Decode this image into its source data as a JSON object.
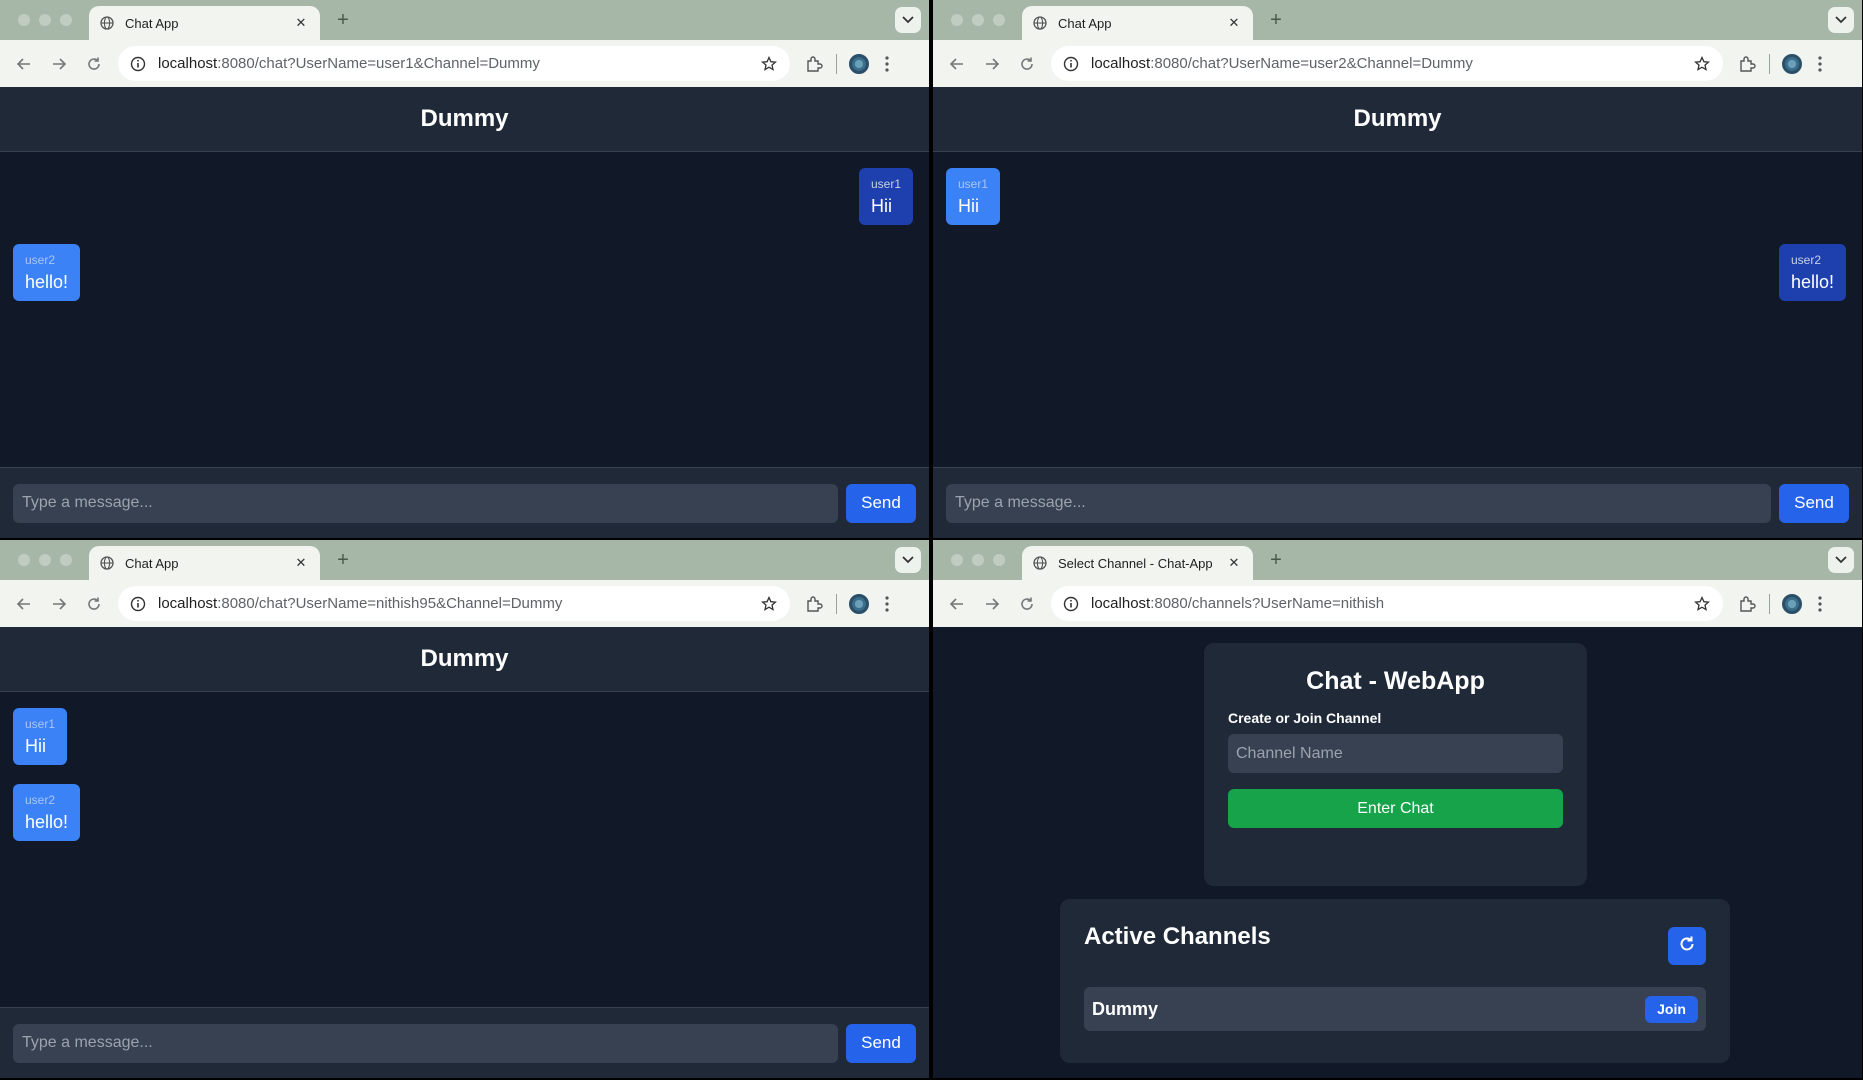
{
  "windows": [
    {
      "tab_title": "Chat App",
      "url_host": "localhost",
      "url_rest": ":8080/chat?UserName=user1&Channel=Dummy",
      "header_title": "Dummy",
      "messages": [
        {
          "user": "user1",
          "text": "Hii",
          "mine": true
        },
        {
          "user": "user2",
          "text": "hello!",
          "mine": false
        }
      ],
      "input_placeholder": "Type a message...",
      "send_label": "Send"
    },
    {
      "tab_title": "Chat App",
      "url_host": "localhost",
      "url_rest": ":8080/chat?UserName=user2&Channel=Dummy",
      "header_title": "Dummy",
      "messages": [
        {
          "user": "user1",
          "text": "Hii",
          "mine": false
        },
        {
          "user": "user2",
          "text": "hello!",
          "mine": true
        }
      ],
      "input_placeholder": "Type a message...",
      "send_label": "Send"
    },
    {
      "tab_title": "Chat App",
      "url_host": "localhost",
      "url_rest": ":8080/chat?UserName=nithish95&Channel=Dummy",
      "header_title": "Dummy",
      "messages": [
        {
          "user": "user1",
          "text": "Hii",
          "mine": false
        },
        {
          "user": "user2",
          "text": "hello!",
          "mine": false
        }
      ],
      "input_placeholder": "Type a message...",
      "send_label": "Send"
    },
    {
      "tab_title": "Select Channel - Chat-App",
      "url_host": "localhost",
      "url_rest": ":8080/channels?UserName=nithish",
      "app_title": "Chat - WebApp",
      "create_label": "Create or Join Channel",
      "channel_placeholder": "Channel Name",
      "enter_label": "Enter Chat",
      "active_title": "Active Channels",
      "channels": [
        {
          "name": "Dummy",
          "join_label": "Join"
        }
      ]
    }
  ]
}
